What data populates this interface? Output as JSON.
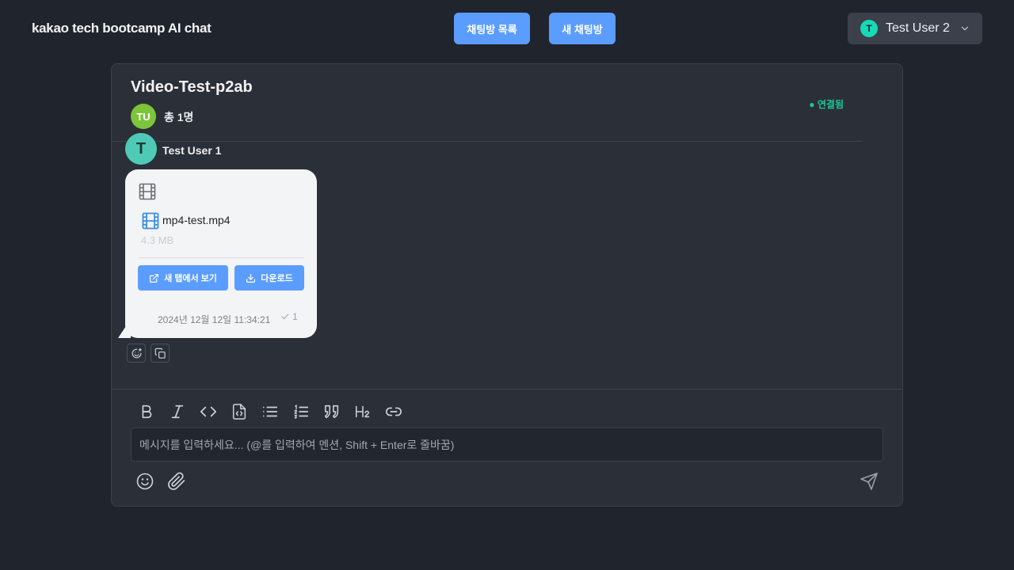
{
  "app": {
    "logo": "kakao tech bootcamp AI chat"
  },
  "nav": {
    "room_list_label": "채팅방 목록",
    "new_room_label": "새 채팅방"
  },
  "user_menu": {
    "avatar_initial": "T",
    "name": "Test User 2"
  },
  "room": {
    "title": "Video-Test-p2ab",
    "member_initials": "TU",
    "member_count": "총 1명",
    "connection_status": "● 연결됨"
  },
  "message": {
    "sender_initial": "T",
    "sender_name": "Test User 1",
    "file_name": "mp4-test.mp4",
    "file_size": "4.3 MB",
    "open_label": "새 탭에서 보기",
    "download_label": "다운로드",
    "timestamp": "2024년 12월 12일 11:34:21",
    "read_count": "1"
  },
  "composer": {
    "placeholder": "메시지를 입력하세요... (@를 입력하여 멘션, Shift + Enter로 줄바꿈)",
    "value": ""
  },
  "colors": {
    "accent": "#5b9dff",
    "connected": "#18c79a",
    "panel": "#2b2f38",
    "background": "#20242d"
  },
  "icons": {
    "toolbar": [
      "bold-icon",
      "italic-icon",
      "code-icon",
      "code-block-icon",
      "bullet-list-icon",
      "numbered-list-icon",
      "quote-icon",
      "heading-icon",
      "link-icon"
    ],
    "bottom": [
      "emoji-icon",
      "paperclip-icon",
      "send-icon"
    ]
  }
}
